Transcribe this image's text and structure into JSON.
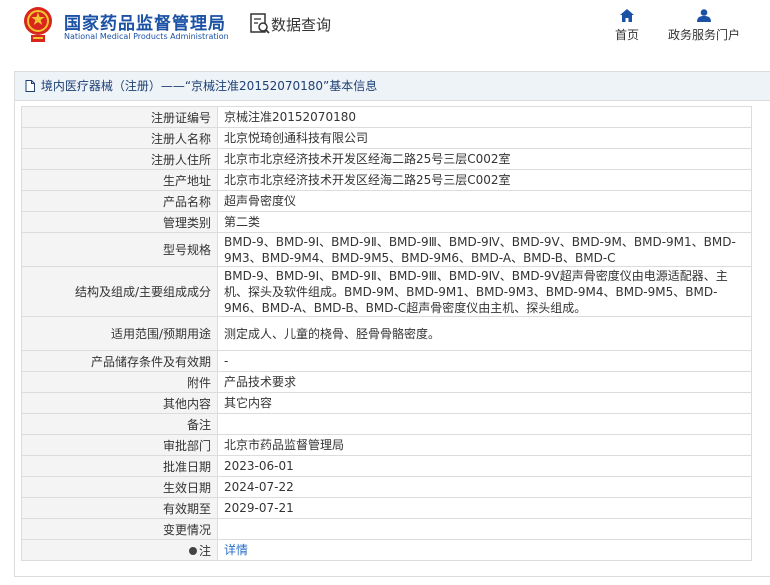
{
  "header": {
    "logo_cn": "国家药品监督管理局",
    "logo_en": "National Medical Products Administration",
    "search_label": "数据查询",
    "nav_home": "首页",
    "nav_service": "政务服务门户"
  },
  "panel": {
    "title": "境内医疗器械（注册）——“京械注准20152070180”基本信息"
  },
  "rows": [
    {
      "label": "注册证编号",
      "value": "京械注准20152070180"
    },
    {
      "label": "注册人名称",
      "value": "北京悦琦创通科技有限公司"
    },
    {
      "label": "注册人住所",
      "value": "北京市北京经济技术开发区经海二路25号三层C002室"
    },
    {
      "label": "生产地址",
      "value": "北京市北京经济技术开发区经海二路25号三层C002室"
    },
    {
      "label": "产品名称",
      "value": "超声骨密度仪"
    },
    {
      "label": "管理类别",
      "value": "第二类"
    },
    {
      "label": "型号规格",
      "value": "BMD-9、BMD-9Ⅰ、BMD-9Ⅱ、BMD-9Ⅲ、BMD-9Ⅳ、BMD-9Ⅴ、BMD-9M、BMD-9M1、BMD-9M3、BMD-9M4、BMD-9M5、BMD-9M6、BMD-A、BMD-B、BMD-C"
    },
    {
      "label": "结构及组成/主要组成成分",
      "value": "BMD-9、BMD-9Ⅰ、BMD-9Ⅱ、BMD-9Ⅲ、BMD-9Ⅳ、BMD-9Ⅴ超声骨密度仪由电源适配器、主机、探头及软件组成。BMD-9M、BMD-9M1、BMD-9M3、BMD-9M4、BMD-9M5、BMD-9M6、BMD-A、BMD-B、BMD-C超声骨密度仪由主机、探头组成。"
    },
    {
      "label": "适用范围/预期用途",
      "value": "测定成人、儿童的桡骨、胫骨骨骼密度。"
    },
    {
      "label": "产品储存条件及有效期",
      "value": "-"
    },
    {
      "label": "附件",
      "value": "产品技术要求"
    },
    {
      "label": "其他内容",
      "value": "其它内容"
    },
    {
      "label": "备注",
      "value": ""
    },
    {
      "label": "审批部门",
      "value": "北京市药品监督管理局"
    },
    {
      "label": "批准日期",
      "value": "2023-06-01"
    },
    {
      "label": "生效日期",
      "value": "2024-07-22"
    },
    {
      "label": "有效期至",
      "value": "2029-07-21"
    },
    {
      "label": "变更情况",
      "value": ""
    }
  ],
  "note_row": {
    "label": "注",
    "link": "详情"
  },
  "colors": {
    "brand_blue": "#1b52a6",
    "link_blue": "#2a6fc9",
    "title_bg": "#eef3f8",
    "label_bg": "#f4f4f4"
  }
}
